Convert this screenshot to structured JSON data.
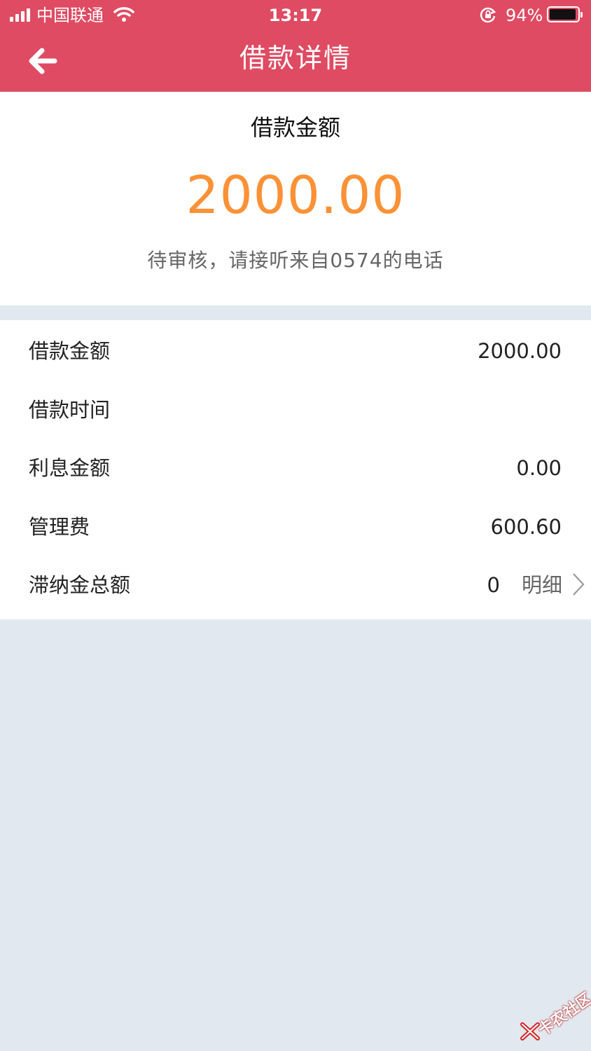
{
  "status_bar": {
    "carrier": "中国联通",
    "time": "13:17",
    "battery_percent": "94%",
    "battery_level": 0.94
  },
  "nav": {
    "title": "借款详情",
    "back_icon": "arrow-left-icon"
  },
  "summary": {
    "label": "借款金额",
    "amount": "2000.00",
    "note": "待审核，请接听来自0574的电话"
  },
  "details": [
    {
      "label": "借款金额",
      "value": "2000.00"
    },
    {
      "label": "借款时间",
      "value": ""
    },
    {
      "label": "利息金额",
      "value": "0.00"
    },
    {
      "label": "管理费",
      "value": "600.60"
    },
    {
      "label": "滞纳金总额",
      "value": "0",
      "link": "明细"
    }
  ],
  "watermark": {
    "text": "卡农社区"
  },
  "colors": {
    "header": "#df4b62",
    "amount": "#fb9136",
    "background": "#e1e8ef"
  }
}
